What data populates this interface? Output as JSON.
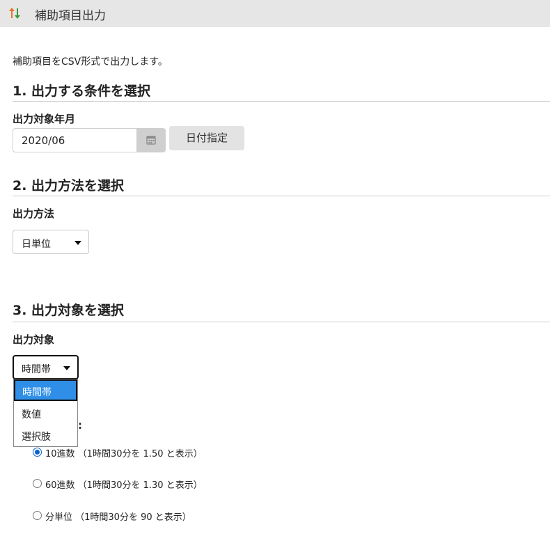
{
  "window": {
    "title": "補助項目出力",
    "icon": "up-down-arrows-icon"
  },
  "intro": "補助項目をCSV形式で出力します。",
  "section1": {
    "heading": "1. 出力する条件を選択",
    "field_label": "出力対象年月",
    "month_value": "2020/06",
    "calendar_icon": "calendar-icon",
    "day_button": "日付指定"
  },
  "section2": {
    "heading": "2. 出力方法を選択",
    "field_label": "出力方法",
    "method_value": "日単位"
  },
  "section3": {
    "heading": "3. 出力対象を選択",
    "field_label": "出力対象",
    "target_value": "時間帯",
    "options": [
      "時間帯",
      "数値",
      "選択肢"
    ],
    "hidden_label_tail": ":",
    "radios": [
      {
        "label": "10進数 （1時間30分を 1.50 と表示）",
        "checked": true
      },
      {
        "label": "60進数 （1時間30分を 1.30 と表示）",
        "checked": false
      },
      {
        "label": "分単位 （1時間30分を 90 と表示）",
        "checked": false
      }
    ]
  },
  "colors": {
    "titlebar_bg": "#e6e6e6",
    "selected_option_bg": "#2e8ee8",
    "radio_checked": "#0b63ce",
    "arrow_up": "#e8742a",
    "arrow_down": "#3a9a3a"
  }
}
